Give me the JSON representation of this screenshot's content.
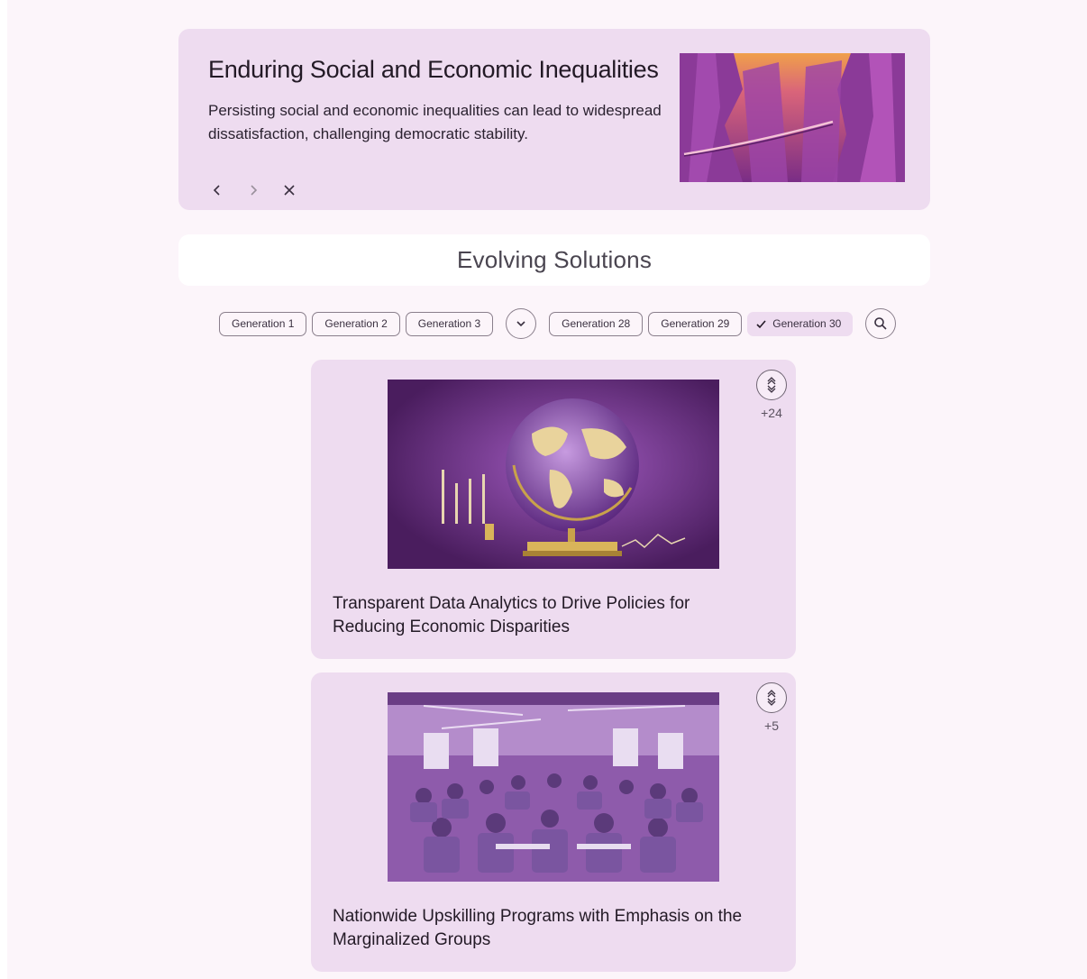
{
  "problem": {
    "title": "Enduring Social and Economic Inequalities",
    "description": "Persisting social and economic inequalities can lead to widespread dissatisfaction, challenging democratic stability.",
    "nav": {
      "prev_icon": "chevron-left-icon",
      "next_icon": "chevron-right-icon",
      "close_icon": "close-icon"
    }
  },
  "section": {
    "title": "Evolving Solutions"
  },
  "generations": {
    "chips": [
      "Generation 1",
      "Generation 2",
      "Generation 3",
      "Generation 28",
      "Generation 29",
      "Generation 30"
    ],
    "selected": "Generation 30",
    "expand_icon": "chevron-down-icon",
    "search_icon": "search-icon"
  },
  "solutions": [
    {
      "title": "Transparent Data Analytics to Drive Policies for Reducing Economic Disparities",
      "votes": "+24",
      "image": "globe-data-illustration"
    },
    {
      "title": "Nationwide Upskilling Programs with Emphasis on the Marginalized Groups",
      "votes": "+5",
      "image": "classroom-training-illustration"
    }
  ],
  "colors": {
    "accent": "#eedcf0",
    "background": "#fcf5fa",
    "text": "#231a26"
  }
}
